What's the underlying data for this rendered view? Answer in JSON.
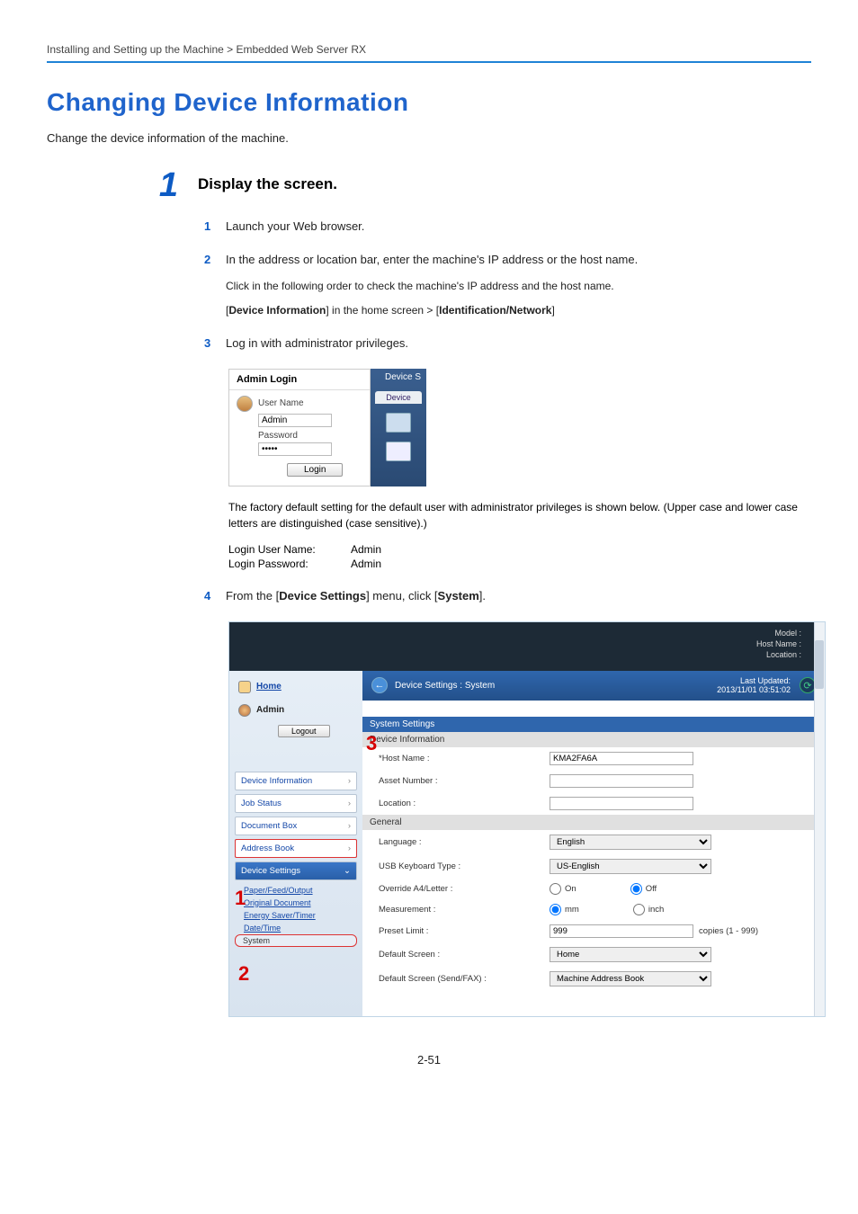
{
  "breadcrumb": "Installing and Setting up the Machine > Embedded Web Server RX",
  "h1": "Changing Device Information",
  "intro": "Change the device information of the machine.",
  "step1": {
    "num": "1",
    "title": "Display the screen.",
    "sub1": {
      "num": "1",
      "text": "Launch your Web browser."
    },
    "sub2": {
      "num": "2",
      "text": "In the address or location bar, enter the machine's IP address or the host name.",
      "note1": "Click in the following order to check the machine's IP address and the host name.",
      "note2a": "[",
      "note2b": "Device Information",
      "note2c": "] in the home screen > [",
      "note2d": "Identification/Network",
      "note2e": "]"
    },
    "sub3": {
      "num": "3",
      "text": "Log in with administrator privileges."
    },
    "sub4": {
      "num": "4",
      "text_a": "From the [",
      "text_b": "Device Settings",
      "text_c": "] menu, click [",
      "text_d": "System",
      "text_e": "]."
    }
  },
  "login": {
    "header": "Admin Login",
    "user_label": "User Name",
    "user_value": "Admin",
    "pass_label": "Password",
    "pass_value": "•••••",
    "login_btn": "Login",
    "right_top": "Device S",
    "right_tag": "Device"
  },
  "after_login": "The factory default setting for the default user with administrator privileges is shown below. (Upper case and lower case letters are distinguished (case sensitive).)",
  "creds": {
    "k1": "Login User Name:",
    "v1": "Admin",
    "k2": "Login Password:",
    "v2": "Admin"
  },
  "shot2": {
    "top": {
      "model_k": "Model :",
      "host_k": "Host Name :",
      "loc_k": "Location :"
    },
    "side": {
      "home": "Home",
      "admin": "Admin",
      "logout": "Logout",
      "dev_info": "Device Information",
      "job_status": "Job Status",
      "doc_box": "Document Box",
      "addr_book": "Address Book",
      "dev_set": "Device Settings",
      "sub_pfo": "Paper/Feed/Output",
      "sub_od": "Original Document",
      "sub_est": "Energy Saver/Timer",
      "sub_dt": "Date/Time",
      "sub_sys": "System"
    },
    "main": {
      "title": "Device Settings : System",
      "upd_k": "Last Updated:",
      "upd_v": "2013/11/01 03:51:02",
      "sect": "System Settings",
      "sub_di": "Device Information",
      "host_k": "*Host Name :",
      "host_v": "KMA2FA6A",
      "asset_k": "Asset Number :",
      "asset_v": "",
      "loc_k": "Location :",
      "loc_v": "",
      "sub_gen": "General",
      "lang_k": "Language :",
      "lang_v": "English",
      "usb_k": "USB Keyboard Type :",
      "usb_v": "US-English",
      "ovr_k": "Override A4/Letter :",
      "ovr_on": "On",
      "ovr_off": "Off",
      "meas_k": "Measurement :",
      "meas_mm": "mm",
      "meas_in": "inch",
      "preset_k": "Preset Limit :",
      "preset_v": "999",
      "preset_hint": "copies (1 - 999)",
      "defscr_k": "Default Screen :",
      "defscr_v": "Home",
      "defscrsf_k": "Default Screen (Send/FAX) :",
      "defscrsf_v": "Machine Address Book"
    },
    "red": {
      "n1": "1",
      "n2": "2",
      "n3": "3"
    }
  },
  "pagenum": "2-51"
}
